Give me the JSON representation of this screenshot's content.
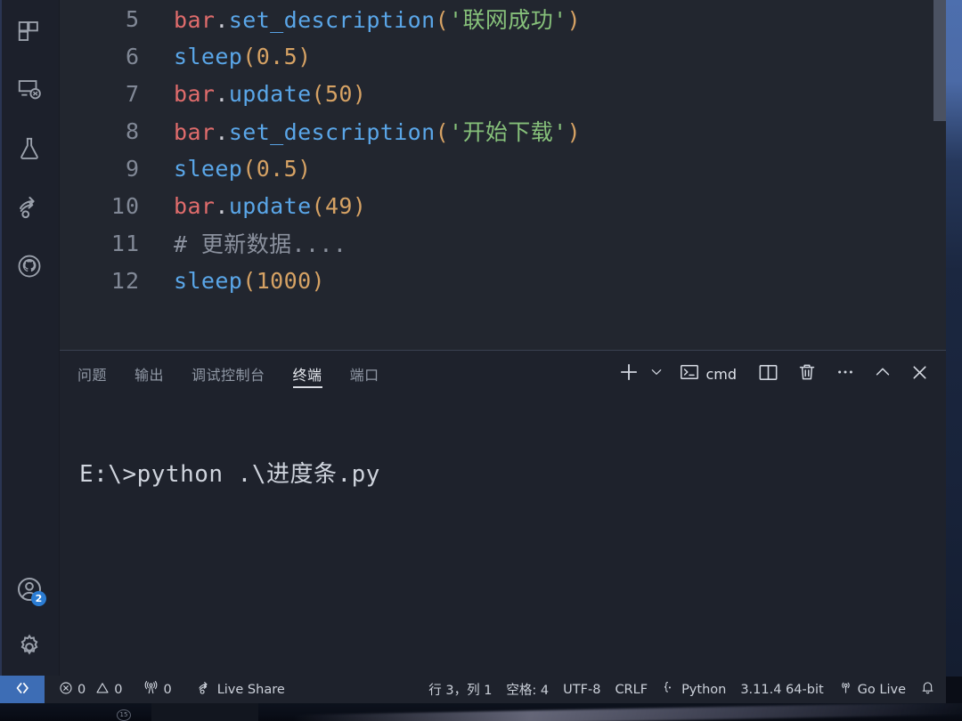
{
  "activity_bar": {
    "items": [
      {
        "name": "extensions-icon",
        "label": "扩展"
      },
      {
        "name": "remote-explorer-icon",
        "label": "远程资源管理器"
      },
      {
        "name": "testing-flask-icon",
        "label": "测试"
      },
      {
        "name": "live-share-icon",
        "label": "Live Share"
      },
      {
        "name": "github-icon",
        "label": "GitHub"
      }
    ],
    "bottom": [
      {
        "name": "accounts-icon",
        "label": "账户",
        "badge": "2"
      },
      {
        "name": "settings-gear-icon",
        "label": "管理",
        "badge": ""
      }
    ]
  },
  "editor": {
    "lines": [
      {
        "number": "5",
        "tokens": [
          {
            "t": "var",
            "v": "bar"
          },
          {
            "t": "punct",
            "v": "."
          },
          {
            "t": "fn",
            "v": "set_description"
          },
          {
            "t": "paren",
            "v": "("
          },
          {
            "t": "str",
            "v": "'联网成功'"
          },
          {
            "t": "paren",
            "v": ")"
          }
        ]
      },
      {
        "number": "6",
        "tokens": [
          {
            "t": "fn",
            "v": "sleep"
          },
          {
            "t": "paren",
            "v": "("
          },
          {
            "t": "num",
            "v": "0.5"
          },
          {
            "t": "paren",
            "v": ")"
          }
        ]
      },
      {
        "number": "7",
        "tokens": [
          {
            "t": "var",
            "v": "bar"
          },
          {
            "t": "punct",
            "v": "."
          },
          {
            "t": "fn",
            "v": "update"
          },
          {
            "t": "paren",
            "v": "("
          },
          {
            "t": "num",
            "v": "50"
          },
          {
            "t": "paren",
            "v": ")"
          }
        ]
      },
      {
        "number": "8",
        "tokens": [
          {
            "t": "var",
            "v": "bar"
          },
          {
            "t": "punct",
            "v": "."
          },
          {
            "t": "fn",
            "v": "set_description"
          },
          {
            "t": "paren",
            "v": "("
          },
          {
            "t": "str",
            "v": "'开始下载'"
          },
          {
            "t": "paren",
            "v": ")"
          }
        ]
      },
      {
        "number": "9",
        "tokens": [
          {
            "t": "fn",
            "v": "sleep"
          },
          {
            "t": "paren",
            "v": "("
          },
          {
            "t": "num",
            "v": "0.5"
          },
          {
            "t": "paren",
            "v": ")"
          }
        ]
      },
      {
        "number": "10",
        "tokens": [
          {
            "t": "var",
            "v": "bar"
          },
          {
            "t": "punct",
            "v": "."
          },
          {
            "t": "fn",
            "v": "update"
          },
          {
            "t": "paren",
            "v": "("
          },
          {
            "t": "num",
            "v": "49"
          },
          {
            "t": "paren",
            "v": ")"
          }
        ]
      },
      {
        "number": "11",
        "tokens": [
          {
            "t": "comment",
            "v": "# 更新数据...."
          }
        ]
      },
      {
        "number": "12",
        "tokens": [
          {
            "t": "fn",
            "v": "sleep"
          },
          {
            "t": "paren",
            "v": "("
          },
          {
            "t": "num",
            "v": "1000"
          },
          {
            "t": "paren",
            "v": ")"
          }
        ]
      }
    ]
  },
  "panel": {
    "tabs": [
      {
        "label": "问题",
        "active": false
      },
      {
        "label": "输出",
        "active": false
      },
      {
        "label": "调试控制台",
        "active": false
      },
      {
        "label": "终端",
        "active": true
      },
      {
        "label": "端口",
        "active": false
      }
    ],
    "actions": {
      "new_terminal": "plus-icon",
      "new_terminal_dropdown": "chevron-down-icon",
      "shell_icon": "terminal-prompt-icon",
      "shell_label": "cmd",
      "split": "split-editor-icon",
      "kill": "trash-icon",
      "more": "ellipsis-icon",
      "maximize": "chevron-up-icon",
      "close": "close-x-icon"
    },
    "terminal": {
      "prompt_line": "E:\\>python .\\进度条.py"
    }
  },
  "status_bar": {
    "remote_icon": "remote-window-icon",
    "left": [
      {
        "name": "problems-errors",
        "icon": "error-circle-icon",
        "text": "0"
      },
      {
        "name": "problems-warnings",
        "icon": "warning-triangle-icon",
        "text": "0"
      },
      {
        "name": "ports-forwarded",
        "icon": "radio-tower-icon",
        "text": "0"
      },
      {
        "name": "live-share",
        "icon": "live-share-icon",
        "text": "Live Share"
      }
    ],
    "right": [
      {
        "name": "cursor-position",
        "icon": "",
        "text": "行 3，列 1"
      },
      {
        "name": "indentation",
        "icon": "",
        "text": "空格: 4"
      },
      {
        "name": "encoding",
        "icon": "",
        "text": "UTF-8"
      },
      {
        "name": "eol",
        "icon": "",
        "text": "CRLF"
      },
      {
        "name": "language-mode",
        "icon": "python-brace-icon",
        "text": "Python"
      },
      {
        "name": "interpreter",
        "icon": "",
        "text": "3.11.4 64-bit"
      },
      {
        "name": "go-live",
        "icon": "broadcast-icon",
        "text": "Go Live"
      },
      {
        "name": "notifications",
        "icon": "bell-icon",
        "text": ""
      }
    ]
  },
  "colors": {
    "editor_bg": "#22262f",
    "panel_bg": "#1e222c",
    "activity_bg": "#1c202b",
    "accent_blue": "#3d6db5",
    "badge_blue": "#2b7cd3",
    "token_var": "#e06c6c",
    "token_fn": "#5aa6e8",
    "token_string": "#86c07a",
    "token_number": "#d6a264",
    "token_comment": "#8b919e"
  }
}
